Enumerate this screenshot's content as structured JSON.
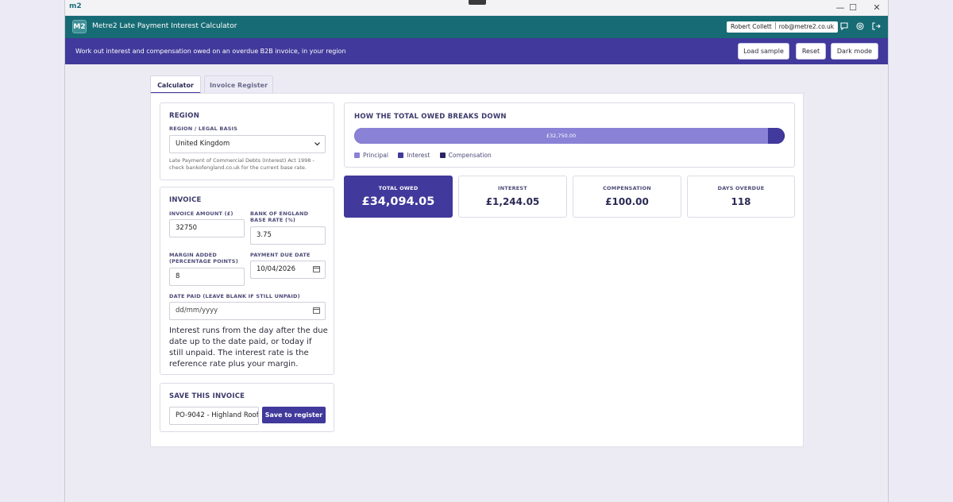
{
  "window": {
    "logo": "m2",
    "controls": {
      "minimize": "—",
      "maximize": "☐",
      "close": "✕"
    }
  },
  "appbar": {
    "badge": "M2",
    "title": "Metre2 Late Payment Interest Calculator",
    "user_name": "Robert Collett",
    "user_email": "rob@metre2.co.uk",
    "icons": {
      "chat": "chat-icon",
      "settings": "gear-icon",
      "logout": "logout-icon"
    }
  },
  "subbar": {
    "description": "Work out interest and compensation owed on an overdue B2B invoice, in your region",
    "buttons": {
      "load_sample": "Load sample",
      "reset": "Reset",
      "dark_mode": "Dark mode"
    }
  },
  "tabs": {
    "calculator": "Calculator",
    "register": "Invoice Register"
  },
  "region": {
    "title": "REGION",
    "label": "REGION / LEGAL BASIS",
    "selected": "United Kingdom",
    "note": "Late Payment of Commercial Debts (Interest) Act 1998 - check bankofengland.co.uk for the current base rate."
  },
  "invoice": {
    "title": "INVOICE",
    "amount_label": "INVOICE AMOUNT (£)",
    "amount_value": "32750",
    "base_rate_label": "BANK OF ENGLAND BASE RATE (%)",
    "base_rate_value": "3.75",
    "margin_label": "MARGIN ADDED (PERCENTAGE POINTS)",
    "margin_value": "8",
    "due_date_label": "PAYMENT DUE DATE",
    "due_date_value": "10/04/2026",
    "date_paid_label": "DATE PAID (LEAVE BLANK IF STILL UNPAID)",
    "date_paid_placeholder": "dd/mm/yyyy",
    "explanation": "Interest runs from the day after the due date up to the date paid, or today if still unpaid. The interest rate is the reference rate plus your margin."
  },
  "save": {
    "title": "SAVE THIS INVOICE",
    "reference_value": "PO-9042 - Highland Roof",
    "button": "Save to register"
  },
  "breakdown": {
    "title": "HOW THE TOTAL OWED BREAKS DOWN",
    "principal_label_on_bar": "£32,750.00",
    "principal_fraction": 0.9605,
    "interest_fraction": 0.0365,
    "compensation_fraction": 0.0029,
    "legend": {
      "principal": "Principal",
      "interest": "Interest",
      "compensation": "Compensation"
    },
    "colors": {
      "principal": "#8a82d6",
      "interest": "#41399b",
      "compensation": "#2a2466"
    }
  },
  "stats": {
    "total_label": "TOTAL OWED",
    "total_value": "£34,094.05",
    "interest_label": "INTEREST",
    "interest_value": "£1,244.05",
    "compensation_label": "COMPENSATION",
    "compensation_value": "£100.00",
    "days_label": "DAYS OVERDUE",
    "days_value": "118"
  }
}
